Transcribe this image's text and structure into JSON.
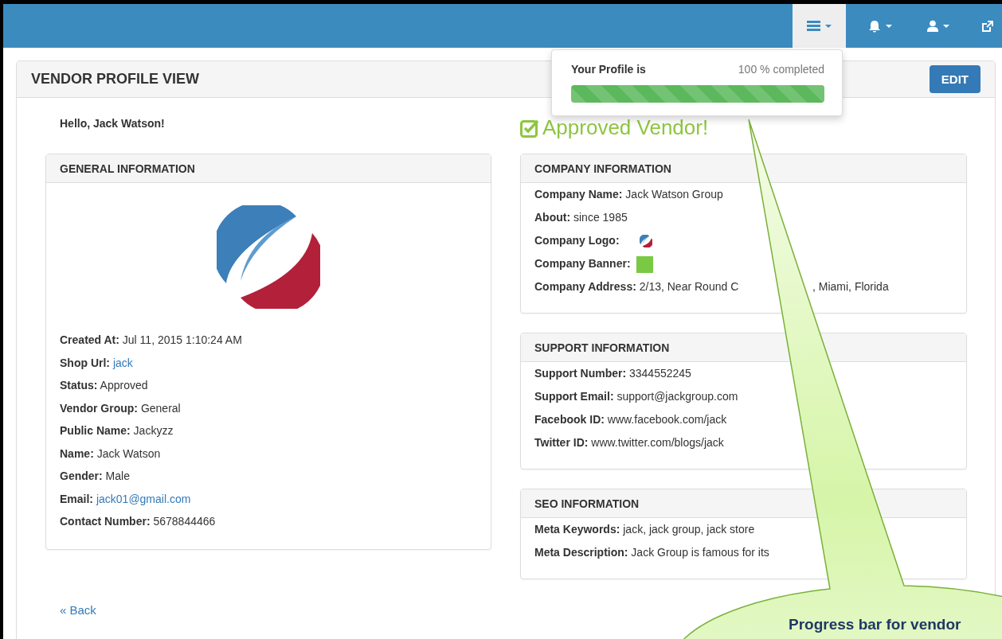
{
  "navbar": {
    "items": [
      {
        "kind": "list",
        "caret": true,
        "selected": true
      },
      {
        "kind": "bell",
        "caret": true,
        "selected": false
      },
      {
        "kind": "user",
        "caret": true,
        "selected": false
      },
      {
        "kind": "external",
        "caret": false,
        "selected": false
      }
    ]
  },
  "profile_popup": {
    "label": "Your Profile is",
    "reading": "100 % completed",
    "level": 1
  },
  "page": {
    "title": "VENDOR PROFILE VIEW",
    "edit_button": "EDIT",
    "greeting": "Hello, Jack Watson!",
    "badge": "Approved Vendor!",
    "back_link": "« Back"
  },
  "general": {
    "title": "GENERAL INFORMATION",
    "fields": [
      {
        "kind": "text",
        "label": "Created At:",
        "value": "Jul 11, 2015 1:10:24 AM"
      },
      {
        "kind": "link",
        "label": "Shop Url:",
        "value": "jack"
      },
      {
        "kind": "text",
        "label": "Status:",
        "value": "Approved"
      },
      {
        "kind": "text",
        "label": "Vendor Group:",
        "value": "General"
      },
      {
        "kind": "text",
        "label": "Public Name:",
        "value": "Jackyzz"
      },
      {
        "kind": "text",
        "label": "Name:",
        "value": "Jack Watson"
      },
      {
        "kind": "text",
        "label": "Gender:",
        "value": "Male"
      },
      {
        "kind": "link",
        "label": "Email:",
        "value": "jack01@gmail.com"
      },
      {
        "kind": "text",
        "label": "Contact Number:",
        "value": "5678844466"
      }
    ]
  },
  "panels": [
    {
      "title": "COMPANY INFORMATION",
      "fields": [
        {
          "kind": "text",
          "label": "Company Name:",
          "value": "Jack Watson Group"
        },
        {
          "kind": "text",
          "label": "About:",
          "value": "since 1985"
        },
        {
          "kind": "logo",
          "label": "Company Logo:"
        },
        {
          "kind": "banner",
          "label": "Company Banner:"
        },
        {
          "kind": "text",
          "label": "Company Address:",
          "value": "2/13, Near Round C",
          "value_after": ", Miami, Florida"
        }
      ]
    },
    {
      "title": "SUPPORT INFORMATION",
      "fields": [
        {
          "kind": "text",
          "label": "Support Number:",
          "value": "3344552245"
        },
        {
          "kind": "text",
          "label": "Support Email:",
          "value": "support@jackgroup.com"
        },
        {
          "kind": "text",
          "label": "Facebook ID:",
          "value": "www.facebook.com/jack"
        },
        {
          "kind": "text",
          "label": "Twitter ID:",
          "value": "www.twitter.com/blogs/jack"
        }
      ]
    },
    {
      "title": "SEO INFORMATION",
      "fields": [
        {
          "kind": "text",
          "label": "Meta Keywords:",
          "value": "jack, jack group, jack store"
        },
        {
          "kind": "text",
          "label": "Meta Description:",
          "value": "Jack Group is famous for its"
        }
      ]
    }
  ],
  "callout": {
    "text": "Progress bar for vendor"
  }
}
